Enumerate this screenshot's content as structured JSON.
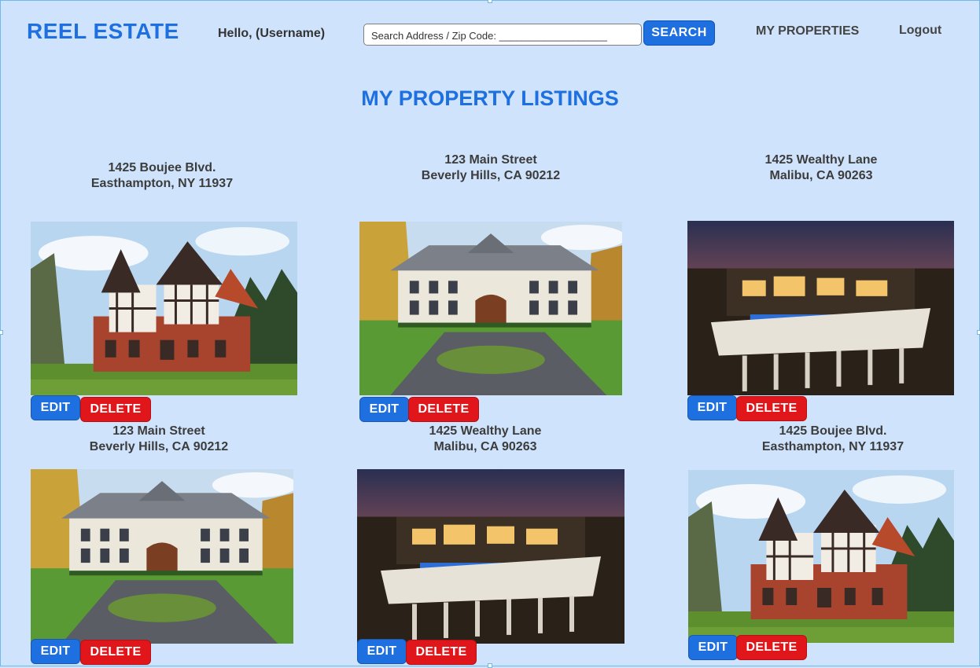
{
  "header": {
    "brand": "REEL ESTATE",
    "greeting": "Hello, (Username)",
    "search_text": "Search Address / Zip Code: ___________________",
    "search_button": "SEARCH",
    "nav_my_properties": "MY PROPERTIES",
    "nav_logout": "Logout"
  },
  "main": {
    "title": "MY PROPERTY LISTINGS",
    "listings": [
      {
        "address_line1": "1425 Boujee Blvd.",
        "address_line2": "Easthampton, NY 11937",
        "photo": "tudor-mansion",
        "edit_label": "EDIT",
        "delete_label": "DELETE"
      },
      {
        "address_line1": "123 Main Street",
        "address_line2": "Beverly Hills, CA 90212",
        "photo": "white-estate",
        "edit_label": "EDIT",
        "delete_label": "DELETE"
      },
      {
        "address_line1": "1425 Wealthy Lane",
        "address_line2": "Malibu, CA 90263",
        "photo": "modern-cliff-house",
        "edit_label": "EDIT",
        "delete_label": "DELETE"
      },
      {
        "address_line1": "123 Main Street",
        "address_line2": "Beverly Hills, CA 90212",
        "photo": "white-estate",
        "edit_label": "EDIT",
        "delete_label": "DELETE"
      },
      {
        "address_line1": "1425 Wealthy Lane",
        "address_line2": "Malibu, CA 90263",
        "photo": "modern-cliff-house",
        "edit_label": "EDIT",
        "delete_label": "DELETE"
      },
      {
        "address_line1": "1425 Boujee Blvd.",
        "address_line2": "Easthampton, NY 11937",
        "photo": "tudor-mansion",
        "edit_label": "EDIT",
        "delete_label": "DELETE"
      }
    ]
  },
  "colors": {
    "background": "#cfe4fc",
    "accent_blue": "#1e6fe0",
    "delete_red": "#e0161b"
  }
}
